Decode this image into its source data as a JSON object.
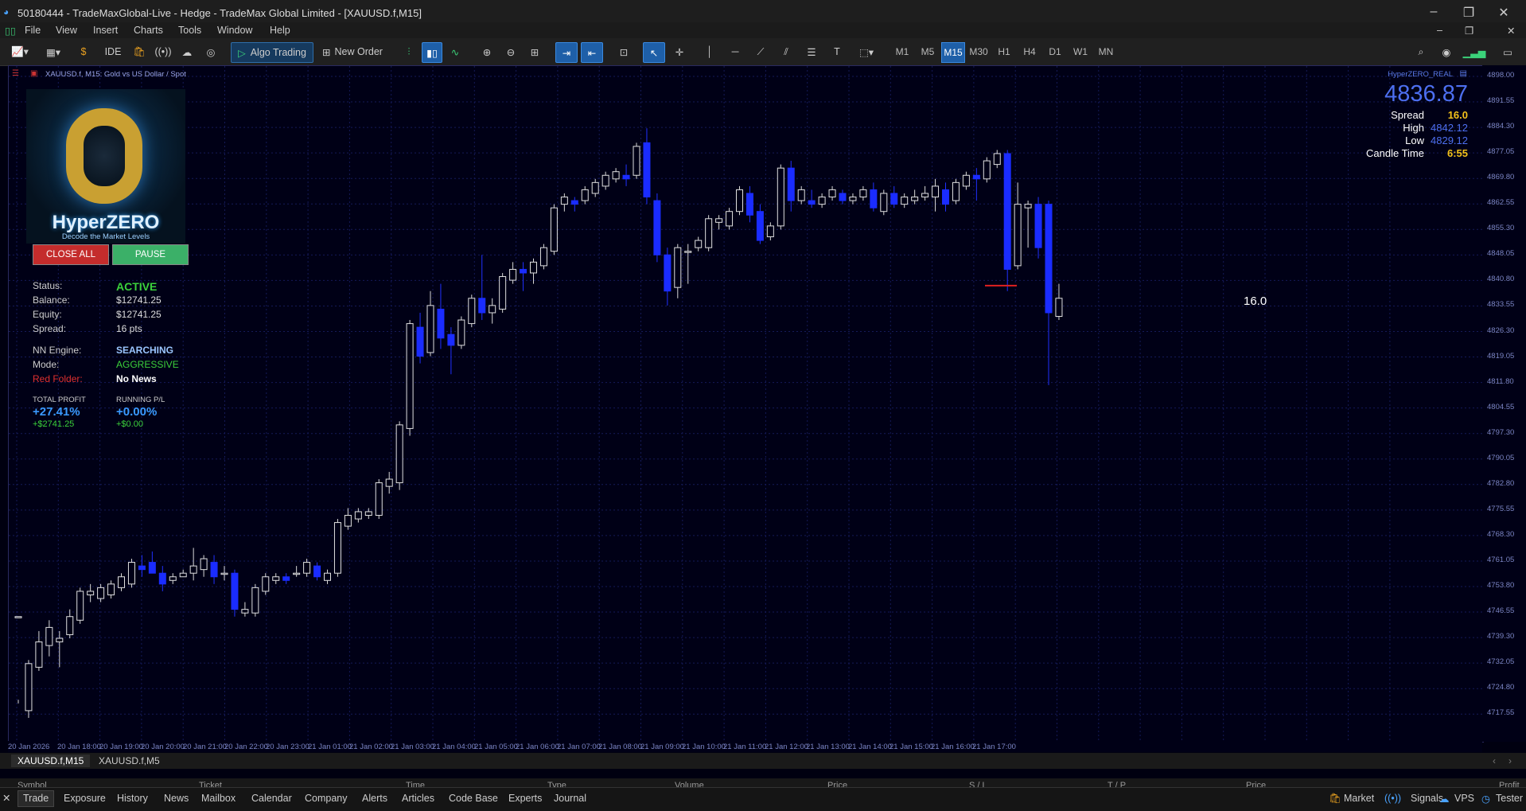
{
  "window": {
    "title": "50180444 - TradeMaxGlobal-Live - Hedge - TradeMax Global Limited - [XAUUSD.f,M15]"
  },
  "menu": [
    "File",
    "View",
    "Insert",
    "Charts",
    "Tools",
    "Window",
    "Help"
  ],
  "toolbar": {
    "ide": "IDE",
    "algo": "Algo Trading",
    "new_order": "New Order",
    "timeframes": [
      "M1",
      "M5",
      "M15",
      "M30",
      "H1",
      "H4",
      "D1",
      "W1",
      "MN"
    ],
    "selected_tf": "M15"
  },
  "chart": {
    "symbol_label": "XAUUSD.f, M15:  Gold vs US Dollar / Spot",
    "indicator_label": "HyperZERO_REAL",
    "spread_marker": "16.0"
  },
  "price_panel": {
    "price": "4836.87",
    "spread_label": "Spread",
    "spread": "16.0",
    "high_label": "High",
    "high": "4842.12",
    "low_label": "Low",
    "low": "4829.12",
    "candle_label": "Candle Time",
    "candle": "6:55"
  },
  "ea": {
    "logo_title": "HyperZERO",
    "logo_tagline": "Decode the Market Levels",
    "close_all": "CLOSE ALL",
    "pause": "PAUSE",
    "status_label": "Status:",
    "status": "ACTIVE",
    "balance_label": "Balance:",
    "balance": "$12741.25",
    "equity_label": "Equity:",
    "equity": "$12741.25",
    "spread_label": "Spread:",
    "spread": "16 pts",
    "nn_label": "NN Engine:",
    "nn": "SEARCHING",
    "mode_label": "Mode:",
    "mode": "AGGRESSIVE",
    "red_label": "Red Folder:",
    "red": "No News",
    "tp_label": "TOTAL PROFIT",
    "tp_pct": "+27.41%",
    "tp_abs": "+$2741.25",
    "rpl_label": "RUNNING P/L",
    "rpl_pct": "+0.00%",
    "rpl_abs": "+$0.00"
  },
  "yaxis": [
    "4898.00",
    "4891.55",
    "4884.30",
    "4877.05",
    "4869.80",
    "4862.55",
    "4855.30",
    "4848.05",
    "4840.80",
    "4833.55",
    "4826.30",
    "4819.05",
    "4811.80",
    "4804.55",
    "4797.30",
    "4790.05",
    "4782.80",
    "4775.55",
    "4768.30",
    "4761.05",
    "4753.80",
    "4746.55",
    "4739.30",
    "4732.05",
    "4724.80",
    "4717.55"
  ],
  "xaxis": [
    "20 Jan 2026",
    "20 Jan 18:00",
    "20 Jan 19:00",
    "20 Jan 20:00",
    "20 Jan 21:00",
    "20 Jan 22:00",
    "20 Jan 23:00",
    "21 Jan 01:00",
    "21 Jan 02:00",
    "21 Jan 03:00",
    "21 Jan 04:00",
    "21 Jan 05:00",
    "21 Jan 06:00",
    "21 Jan 07:00",
    "21 Jan 08:00",
    "21 Jan 09:00",
    "21 Jan 10:00",
    "21 Jan 11:00",
    "21 Jan 12:00",
    "21 Jan 13:00",
    "21 Jan 14:00",
    "21 Jan 15:00",
    "21 Jan 16:00",
    "21 Jan 17:00"
  ],
  "symbol_tabs": [
    "XAUUSD.f,M15",
    "XAUUSD.f,M5"
  ],
  "table_headers": [
    "Symbol",
    "Ticket",
    "Time",
    "Type",
    "Volume",
    "Price",
    "S / L",
    "T / P",
    "Price",
    "Profit"
  ],
  "bottom_tabs": [
    "Trade",
    "Exposure",
    "History",
    "News",
    "Mailbox",
    "Calendar",
    "Company",
    "Alerts",
    "Articles",
    "Code Base",
    "Experts",
    "Journal"
  ],
  "status_right": [
    "Market",
    "Signals",
    "VPS",
    "Tester"
  ],
  "candles": [
    [
      4748,
      4748,
      4725,
      4724
    ],
    [
      4722,
      4735,
      4720,
      4736
    ],
    [
      4734,
      4741,
      4733,
      4744
    ],
    [
      4740,
      4745,
      4737,
      4747
    ],
    [
      4741,
      4742,
      4734,
      4744
    ],
    [
      4743,
      4748,
      4742,
      4750
    ],
    [
      4747,
      4755,
      4746,
      4756
    ],
    [
      4754,
      4755,
      4752,
      4757
    ],
    [
      4753,
      4756,
      4752,
      4757
    ],
    [
      4754,
      4757,
      4753,
      4758
    ],
    [
      4756,
      4759,
      4755,
      4760
    ],
    [
      4757,
      4763,
      4756,
      4764
    ],
    [
      4762,
      4761,
      4759,
      4765
    ],
    [
      4763,
      4760,
      4760,
      4766
    ],
    [
      4760,
      4757,
      4755,
      4762
    ],
    [
      4758,
      4759,
      4757,
      4760
    ],
    [
      4759,
      4760,
      4759,
      4761
    ],
    [
      4760,
      4762,
      4758,
      4767
    ],
    [
      4761,
      4764,
      4759,
      4765
    ],
    [
      4763,
      4759,
      4757,
      4765
    ],
    [
      4760,
      4760,
      4758,
      4762
    ],
    [
      4760,
      4750,
      4748,
      4761
    ],
    [
      4749,
      4750,
      4748,
      4752
    ],
    [
      4749,
      4756,
      4748,
      4757
    ],
    [
      4755,
      4759,
      4754,
      4760
    ],
    [
      4758,
      4759,
      4757,
      4760
    ],
    [
      4759,
      4758,
      4757,
      4760
    ],
    [
      4760,
      4760,
      4759,
      4762
    ],
    [
      4760,
      4763,
      4759,
      4764
    ],
    [
      4762,
      4759,
      4758,
      4763
    ],
    [
      4758,
      4760,
      4757,
      4761
    ],
    [
      4760,
      4774,
      4759,
      4775
    ],
    [
      4773,
      4776,
      4772,
      4778
    ],
    [
      4775,
      4777,
      4774,
      4778
    ],
    [
      4776,
      4777,
      4775,
      4778
    ],
    [
      4776,
      4785,
      4775,
      4786
    ],
    [
      4784,
      4786,
      4782,
      4788
    ],
    [
      4785,
      4801,
      4783,
      4802
    ],
    [
      4800,
      4829,
      4798,
      4830
    ],
    [
      4828,
      4820,
      4818,
      4832
    ],
    [
      4821,
      4834,
      4820,
      4838
    ],
    [
      4833,
      4825,
      4822,
      4840
    ],
    [
      4826,
      4823,
      4815,
      4828
    ],
    [
      4823,
      4830,
      4822,
      4831
    ],
    [
      4829,
      4836,
      4828,
      4837
    ],
    [
      4836,
      4832,
      4830,
      4848
    ],
    [
      4832,
      4834,
      4829,
      4836
    ],
    [
      4833,
      4842,
      4832,
      4843
    ],
    [
      4841,
      4844,
      4840,
      4846
    ],
    [
      4844,
      4843,
      4838,
      4846
    ],
    [
      4843,
      4846,
      4840,
      4847
    ],
    [
      4845,
      4850,
      4844,
      4851
    ],
    [
      4849,
      4861,
      4848,
      4862
    ],
    [
      4862,
      4864,
      4860,
      4865
    ],
    [
      4863,
      4862,
      4860,
      4864
    ],
    [
      4863,
      4866,
      4862,
      4867
    ],
    [
      4865,
      4868,
      4864,
      4869
    ],
    [
      4867,
      4870,
      4866,
      4871
    ],
    [
      4869,
      4871,
      4868,
      4872
    ],
    [
      4870,
      4869,
      4867,
      4873
    ],
    [
      4870,
      4878,
      4869,
      4879
    ],
    [
      4879,
      4864,
      4862,
      4883
    ],
    [
      4863,
      4848,
      4846,
      4865
    ],
    [
      4848,
      4838,
      4834,
      4850
    ],
    [
      4839,
      4850,
      4836,
      4851
    ],
    [
      4849,
      4849,
      4840,
      4851
    ],
    [
      4850,
      4852,
      4849,
      4853
    ],
    [
      4850,
      4858,
      4849,
      4859
    ],
    [
      4857,
      4858,
      4855,
      4859
    ],
    [
      4856,
      4860,
      4855,
      4861
    ],
    [
      4860,
      4866,
      4859,
      4867
    ],
    [
      4865,
      4859,
      4857,
      4867
    ],
    [
      4860,
      4852,
      4851,
      4862
    ],
    [
      4853,
      4856,
      4852,
      4857
    ],
    [
      4856,
      4872,
      4855,
      4873
    ],
    [
      4872,
      4863,
      4860,
      4874
    ],
    [
      4863,
      4866,
      4862,
      4867
    ],
    [
      4863,
      4862,
      4861,
      4866
    ],
    [
      4862,
      4864,
      4861,
      4865
    ],
    [
      4864,
      4866,
      4863,
      4867
    ],
    [
      4865,
      4863,
      4862,
      4866
    ],
    [
      4863,
      4864,
      4862,
      4865
    ],
    [
      4864,
      4866,
      4863,
      4867
    ],
    [
      4866,
      4861,
      4860,
      4868
    ],
    [
      4860,
      4865,
      4859,
      4866
    ],
    [
      4865,
      4862,
      4861,
      4867
    ],
    [
      4862,
      4864,
      4861,
      4865
    ],
    [
      4863,
      4864,
      4862,
      4866
    ],
    [
      4864,
      4865,
      4863,
      4867
    ],
    [
      4864,
      4867,
      4860,
      4869
    ],
    [
      4866,
      4862,
      4860,
      4868
    ],
    [
      4863,
      4868,
      4862,
      4869
    ],
    [
      4867,
      4870,
      4866,
      4871
    ],
    [
      4870,
      4869,
      4863,
      4872
    ],
    [
      4869,
      4874,
      4868,
      4875
    ],
    [
      4873,
      4876,
      4872,
      4877
    ],
    [
      4876,
      4844,
      4838,
      4877
    ],
    [
      4845,
      4862,
      4844,
      4868
    ],
    [
      4861,
      4862,
      4850,
      4863
    ],
    [
      4862,
      4850,
      4847,
      4864
    ],
    [
      4862,
      4832,
      4812,
      4863
    ],
    [
      4831,
      4836,
      4830,
      4840
    ]
  ]
}
